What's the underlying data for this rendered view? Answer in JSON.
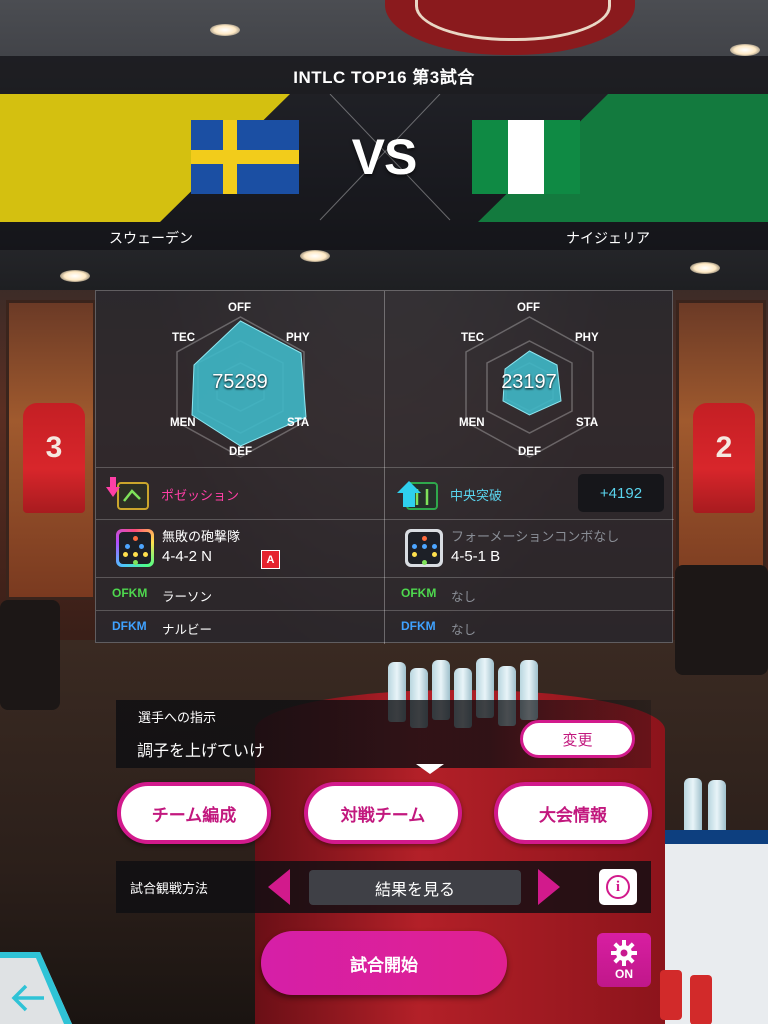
{
  "header": {
    "title": "INTLC TOP16 第3試合"
  },
  "match": {
    "vs_label": "VS",
    "home": {
      "name": "スウェーデン",
      "flag": "sweden-flag",
      "color": "#d4c010"
    },
    "away": {
      "name": "ナイジェリア",
      "flag": "nigeria-flag",
      "color": "#137a3e"
    }
  },
  "radar_axes": [
    "OFF",
    "PHY",
    "STA",
    "DEF",
    "MEN",
    "TEC"
  ],
  "home_stats": {
    "score": "75289",
    "style_label": "ポゼッション",
    "style_icon": "possession-icon",
    "combo": "無敗の砲撃隊",
    "formation": "4-4-2 N",
    "rank_badge": "A",
    "ofk_tag": "OFKM",
    "ofk_player": "ラーソン",
    "dfk_tag": "DFKM",
    "dfk_player": "ナルビー"
  },
  "away_stats": {
    "score": "23197",
    "style_label": "中央突破",
    "style_icon": "central-break-icon",
    "bonus": "+4192",
    "combo": "フォーメーションコンボなし",
    "formation": "4-5-1 B",
    "ofk_tag": "OFKM",
    "ofk_player": "なし",
    "dfk_tag": "DFKM",
    "dfk_player": "なし"
  },
  "instruction": {
    "label": "選手への指示",
    "value": "調子を上げていけ",
    "change_label": "変更"
  },
  "menu": {
    "team_edit": "チーム編成",
    "opponent": "対戦チーム",
    "tournament": "大会情報"
  },
  "watch": {
    "label": "試合観戦方法",
    "value": "結果を見る"
  },
  "actions": {
    "start": "試合開始",
    "settings_state": "ON"
  },
  "colors": {
    "accent": "#d21a8c",
    "radar_fill": "#3fb8c8",
    "style_home": "#ff3fa6",
    "style_away": "#5ad4ee"
  }
}
